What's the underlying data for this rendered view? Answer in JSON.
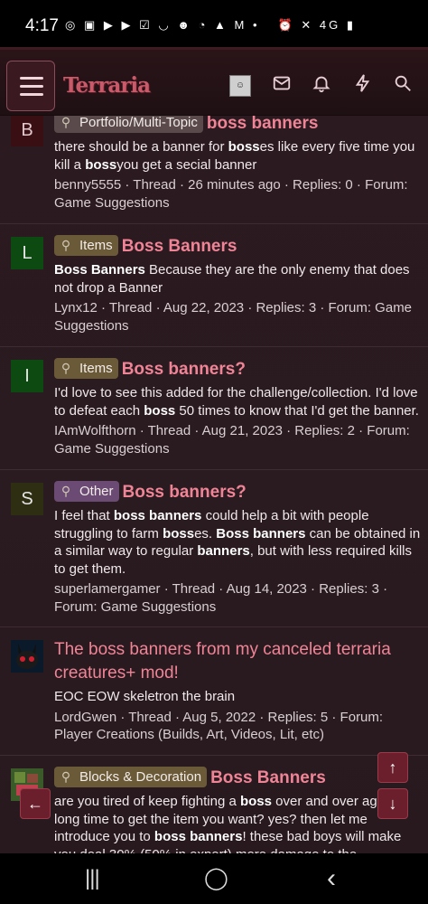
{
  "status": {
    "time": "4:17",
    "left_icons": "◎ ▣ ▶ ▶ ☑ ◡ ☻ ◔ ▲ M •",
    "right_icons": "⏰ ✕ 4G ▮"
  },
  "header": {
    "logo": "Terraria",
    "menu_icon": "hamburger-icon",
    "icons": [
      "user-avatar",
      "mail-icon",
      "bell-icon",
      "bolt-icon",
      "search-icon"
    ]
  },
  "results": [
    {
      "avatar_letter": "B",
      "avatar_color": "#3a0f14",
      "prefix": "Portfolio/Multi-Topic",
      "title": "boss banners",
      "snippet_html_parts": [
        {
          "t": "there should be a banner for ",
          "b": false
        },
        {
          "t": "boss",
          "b": true
        },
        {
          "t": "es like every five time you kill a ",
          "b": false
        },
        {
          "t": "boss",
          "b": true
        },
        {
          "t": "you get a secial banner",
          "b": false
        }
      ],
      "meta": "benny5555 · Thread · 26 minutes ago · Replies: 0 · Forum: Game Suggestions"
    },
    {
      "avatar_letter": "L",
      "avatar_color": "#0d4a12",
      "prefix": "Items",
      "title": "Boss Banners",
      "snippet_html_parts": [
        {
          "t": "Boss Banners",
          "b": true
        },
        {
          "t": " Because they are the only enemy that does not drop a Banner",
          "b": false
        }
      ],
      "meta": "Lynx12 · Thread · Aug 22, 2023 · Replies: 3 · Forum: Game Suggestions"
    },
    {
      "avatar_letter": "I",
      "avatar_color": "#0d4a12",
      "prefix": "Items",
      "title": "Boss banners?",
      "snippet_html_parts": [
        {
          "t": "I'd love to see this added for the challenge/collection. I'd love to defeat each ",
          "b": false
        },
        {
          "t": "boss",
          "b": true
        },
        {
          "t": " 50 times to know that I'd get the banner.",
          "b": false
        }
      ],
      "meta": "IAmWolfthorn · Thread · Aug 21, 2023 · Replies: 2 · Forum: Game Suggestions"
    },
    {
      "avatar_letter": "S",
      "avatar_color": "#2e2e12",
      "prefix": "Other",
      "title": "Boss banners?",
      "snippet_html_parts": [
        {
          "t": "I feel that ",
          "b": false
        },
        {
          "t": "boss banners",
          "b": true
        },
        {
          "t": " could help a bit with people struggling to farm ",
          "b": false
        },
        {
          "t": "boss",
          "b": true
        },
        {
          "t": "es. ",
          "b": false
        },
        {
          "t": "Boss banners",
          "b": true
        },
        {
          "t": " can be obtained in a similar way to regular ",
          "b": false
        },
        {
          "t": "banners",
          "b": true
        },
        {
          "t": ", but with less required kills to get them.",
          "b": false
        }
      ],
      "meta": "superlamergamer · Thread · Aug 14, 2023 · Replies: 3 · Forum: Game Suggestions"
    },
    {
      "avatar_letter": "",
      "avatar_color": "#0a1a2a",
      "prefix": "",
      "title": "The boss banners from my canceled terraria creatures+ mod!",
      "snippet_html_parts": [
        {
          "t": "EOC EOW skeletron the brain",
          "b": false
        }
      ],
      "meta": "LordGwen · Thread · Aug 5, 2022 · Replies: 5 · Forum: Player Creations (Builds, Art, Videos, Lit, etc)"
    },
    {
      "avatar_letter": "",
      "avatar_color": "#3a5a2a",
      "prefix": "Blocks & Decoration",
      "title": "Boss Banners",
      "snippet_html_parts": [
        {
          "t": "are you tired of keep fighting a ",
          "b": false
        },
        {
          "t": "boss",
          "b": true
        },
        {
          "t": " over and over aga a long time to get the item you want? yes? then let me introduce you to ",
          "b": false
        },
        {
          "t": "boss banners",
          "b": true
        },
        {
          "t": "! these bad boys will make you deal 30% (50% in expert) more damage to the",
          "b": false
        }
      ],
      "meta": ""
    }
  ],
  "fab": {
    "up": "↑",
    "down": "↓",
    "back": "←"
  },
  "navbar": {
    "recent": "|||",
    "home": "◯",
    "back": "‹"
  }
}
